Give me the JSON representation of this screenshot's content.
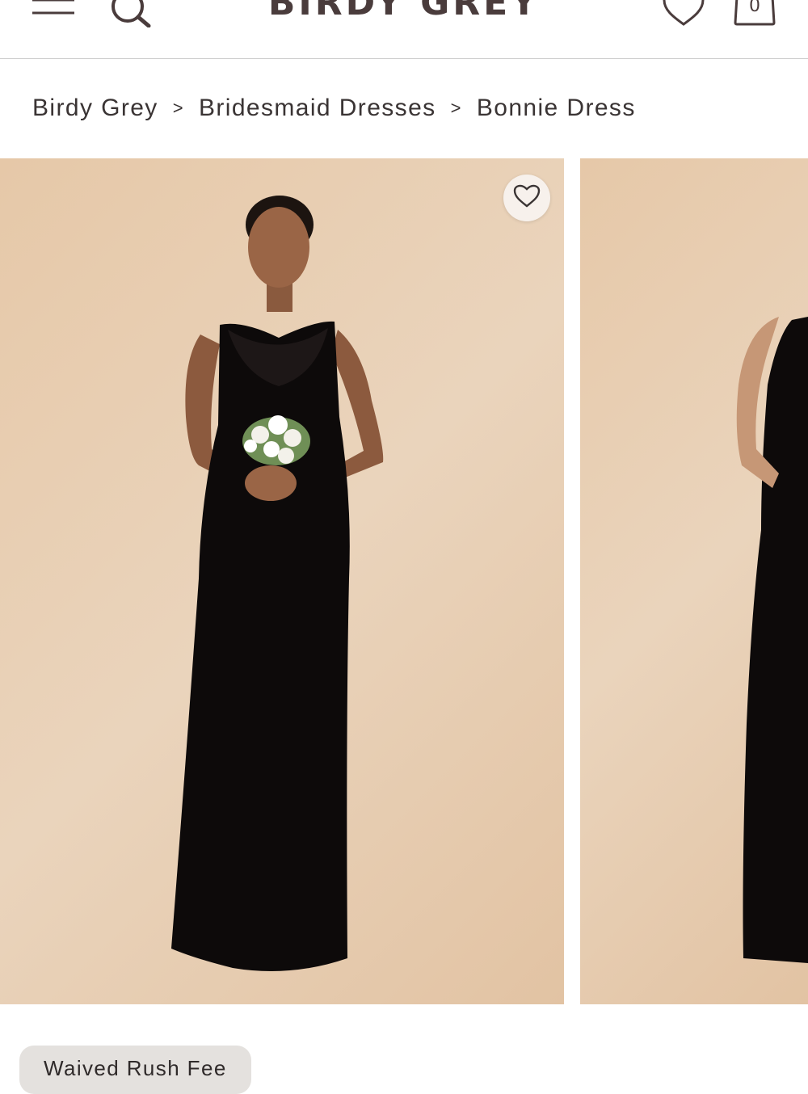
{
  "header": {
    "brand": "BIRDY GREY",
    "cart_count": "0",
    "icons": {
      "menu": "hamburger-menu-icon",
      "search": "search-icon",
      "wishlist": "heart-outline-icon",
      "cart": "shopping-bag-icon"
    }
  },
  "breadcrumb": {
    "items": [
      "Birdy Grey",
      "Bridesmaid Dresses",
      "Bonnie Dress"
    ],
    "separator": ">"
  },
  "gallery": {
    "favorite_icon": "heart-outline-icon",
    "background_color": "#e6c8a8",
    "dress_color": "#0d0a0a"
  },
  "badge": {
    "label": "Waived Rush Fee"
  }
}
